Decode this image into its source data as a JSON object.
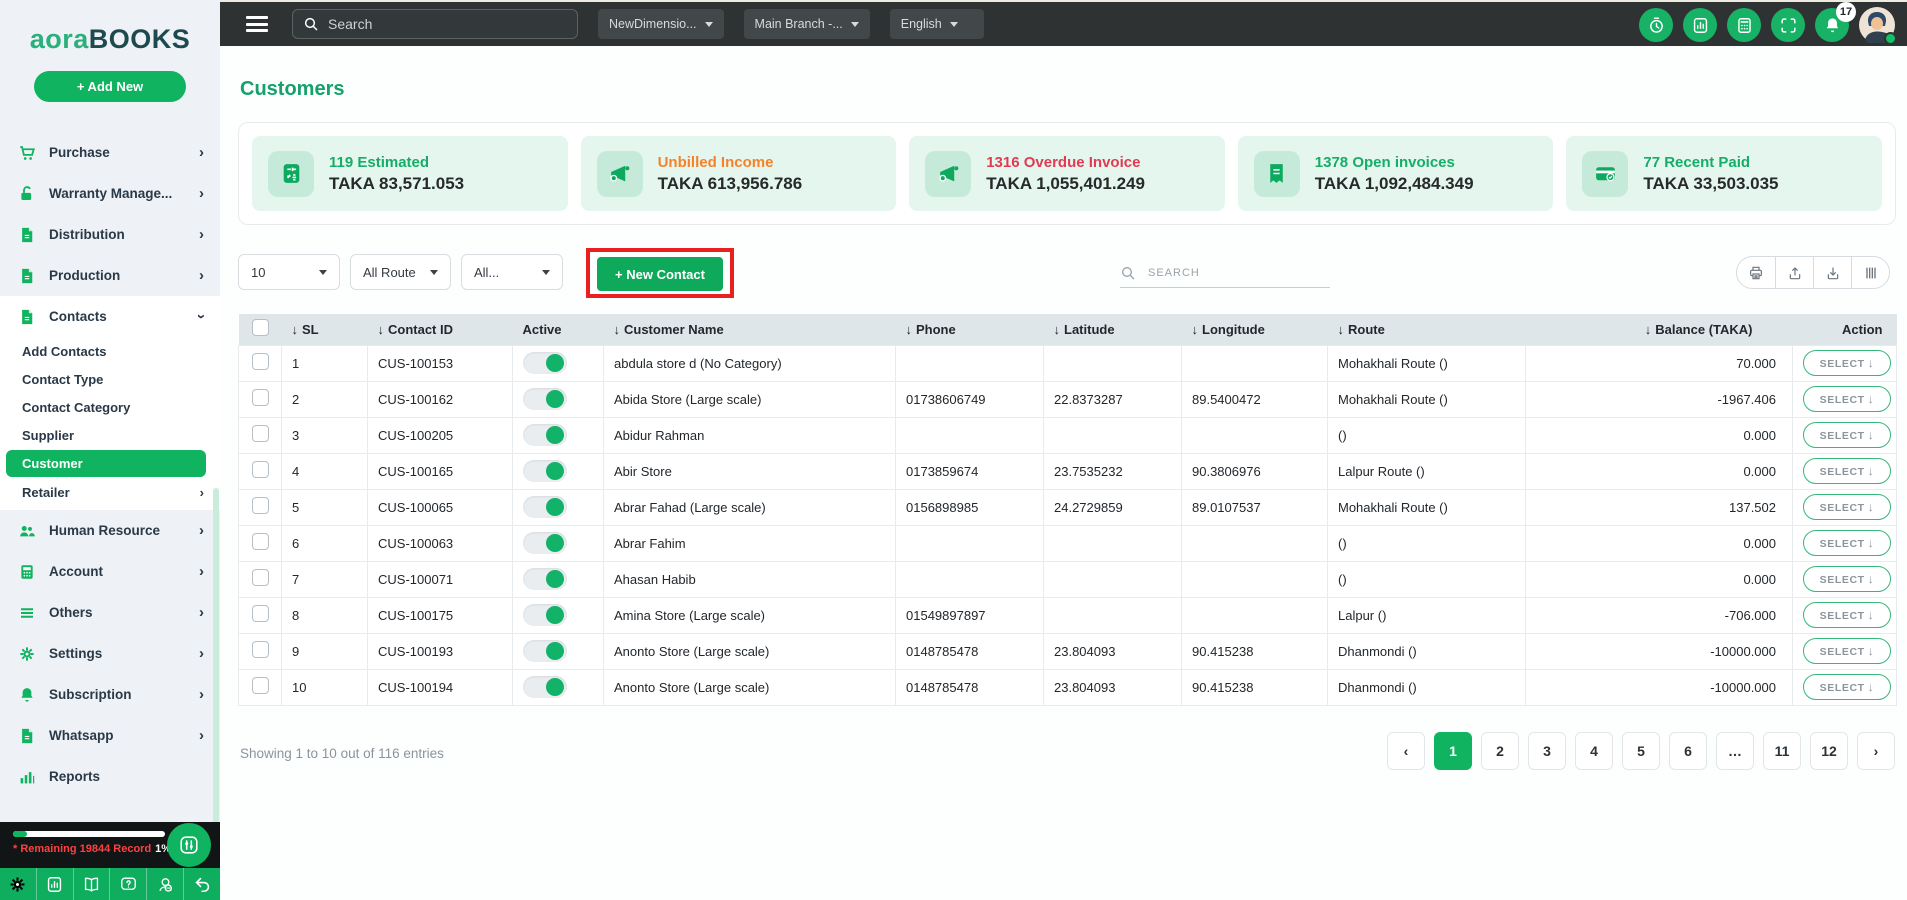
{
  "colors": {
    "primary_green": "#10b35f",
    "topbar_dark": "#2e3233",
    "sidebar_bg": "#eef1f5",
    "card_mint": "#e4f6ed",
    "orange": "#f5822b",
    "red": "#e23b51",
    "annotation_red": "#e8201f"
  },
  "sidebar": {
    "logo_part1": "aora",
    "logo_part2": "BOOKS",
    "add_new_label": "+ Add New",
    "items_top": [
      {
        "label": "Purchase",
        "icon": "cart-icon"
      },
      {
        "label": "Warranty Manage...",
        "icon": "lock-icon"
      },
      {
        "label": "Distribution",
        "icon": "file-icon"
      },
      {
        "label": "Production",
        "icon": "file-icon"
      }
    ],
    "contacts_item": {
      "label": "Contacts",
      "icon": "file-icon"
    },
    "submenu": [
      {
        "label": "Add Contacts"
      },
      {
        "label": "Contact Type"
      },
      {
        "label": "Contact Category"
      },
      {
        "label": "Supplier"
      },
      {
        "label": "Customer",
        "active": true
      },
      {
        "label": "Retailer",
        "chevron": true
      }
    ],
    "items_bottom": [
      {
        "label": "Human Resource",
        "icon": "people-icon"
      },
      {
        "label": "Account",
        "icon": "calculator-icon"
      },
      {
        "label": "Others",
        "icon": "list-icon"
      },
      {
        "label": "Settings",
        "icon": "gear-icon"
      },
      {
        "label": "Subscription",
        "icon": "bell-icon"
      },
      {
        "label": "Whatsapp",
        "icon": "file-icon"
      },
      {
        "label": "Reports",
        "icon": "chart-icon",
        "no_chevron": true
      }
    ],
    "usage": {
      "remaining_label": "* Remaining 19844 Record",
      "percent_label": "1%",
      "progress_pct": 9
    },
    "bottom_icons": [
      "gear-icon",
      "chart-box-icon",
      "book-icon",
      "help-icon",
      "support-icon",
      "undo-icon"
    ]
  },
  "topbar": {
    "search_placeholder": "Search",
    "dropdowns": [
      "NewDimensio...",
      "Main Branch -...",
      "English"
    ],
    "action_icons": [
      "timer-icon",
      "chart-box-icon",
      "calc-white-icon",
      "scan-icon",
      "bell-white-icon"
    ],
    "notification_count": "17"
  },
  "page": {
    "title": "Customers"
  },
  "stat_cards": [
    {
      "title": "119 Estimated",
      "value": "TAKA 83,571.053",
      "color": "#16ad68",
      "icon": "estimate-icon"
    },
    {
      "title": "Unbilled Income",
      "value": "TAKA 613,956.786",
      "color": "#f5822b",
      "icon": "megaphone-icon"
    },
    {
      "title": "1316 Overdue Invoice",
      "value": "TAKA 1,055,401.249",
      "color": "#e23b51",
      "icon": "megaphone-icon"
    },
    {
      "title": "1378 Open invoices",
      "value": "TAKA 1,092,484.349",
      "color": "#16ad68",
      "icon": "invoice-icon"
    },
    {
      "title": "77 Recent Paid",
      "value": "TAKA 33,503.035",
      "color": "#16ad68",
      "icon": "card-icon"
    }
  ],
  "controls": {
    "page_size": "10",
    "route_filter": "All Route",
    "category_filter": "All...",
    "new_contact_label": "+ New Contact",
    "search_placeholder": "SEARCH",
    "tool_icons": [
      "printer-icon",
      "upload-icon",
      "download-icon",
      "columns-icon"
    ]
  },
  "table": {
    "headers": [
      {
        "label": "SL",
        "sort": true
      },
      {
        "label": "Contact ID",
        "sort": true
      },
      {
        "label": "Active",
        "sort": false
      },
      {
        "label": "Customer Name",
        "sort": true
      },
      {
        "label": "Phone",
        "sort": true
      },
      {
        "label": "Latitude",
        "sort": true
      },
      {
        "label": "Longitude",
        "sort": true
      },
      {
        "label": "Route",
        "sort": true
      },
      {
        "label": "Balance (TAKA)",
        "sort": true
      },
      {
        "label": "Action",
        "sort": false
      }
    ],
    "select_label": "SELECT",
    "rows": [
      {
        "sl": "1",
        "contact_id": "CUS-100153",
        "name": "abdula store d (No Category)",
        "phone": "",
        "lat": "",
        "lon": "",
        "route": "Mohakhali Route ()",
        "balance": "70.000"
      },
      {
        "sl": "2",
        "contact_id": "CUS-100162",
        "name": "Abida Store (Large scale)",
        "phone": "01738606749",
        "lat": "22.8373287",
        "lon": "89.5400472",
        "route": "Mohakhali Route ()",
        "balance": "-1967.406"
      },
      {
        "sl": "3",
        "contact_id": "CUS-100205",
        "name": "Abidur Rahman",
        "phone": "",
        "lat": "",
        "lon": "",
        "route": "()",
        "balance": "0.000"
      },
      {
        "sl": "4",
        "contact_id": "CUS-100165",
        "name": "Abir Store",
        "phone": "0173859674",
        "lat": "23.7535232",
        "lon": "90.3806976",
        "route": "Lalpur Route ()",
        "balance": "0.000"
      },
      {
        "sl": "5",
        "contact_id": "CUS-100065",
        "name": "Abrar Fahad (Large scale)",
        "phone": "0156898985",
        "lat": "24.2729859",
        "lon": "89.0107537",
        "route": "Mohakhali Route ()",
        "balance": "137.502"
      },
      {
        "sl": "6",
        "contact_id": "CUS-100063",
        "name": "Abrar Fahim",
        "phone": "",
        "lat": "",
        "lon": "",
        "route": "()",
        "balance": "0.000"
      },
      {
        "sl": "7",
        "contact_id": "CUS-100071",
        "name": "Ahasan Habib",
        "phone": "",
        "lat": "",
        "lon": "",
        "route": "()",
        "balance": "0.000"
      },
      {
        "sl": "8",
        "contact_id": "CUS-100175",
        "name": "Amina Store (Large scale)",
        "phone": "01549897897",
        "lat": "",
        "lon": "",
        "route": "Lalpur ()",
        "balance": "-706.000"
      },
      {
        "sl": "9",
        "contact_id": "CUS-100193",
        "name": "Anonto Store (Large scale)",
        "phone": "0148785478",
        "lat": "23.804093",
        "lon": "90.415238",
        "route": "Dhanmondi ()",
        "balance": "-10000.000"
      },
      {
        "sl": "10",
        "contact_id": "CUS-100194",
        "name": "Anonto Store (Large scale)",
        "phone": "0148785478",
        "lat": "23.804093",
        "lon": "90.415238",
        "route": "Dhanmondi ()",
        "balance": "-10000.000"
      }
    ]
  },
  "footer": {
    "showing_text": "Showing 1 to 10 out of 116 entries",
    "pages": [
      "1",
      "2",
      "3",
      "4",
      "5",
      "6",
      "…",
      "11",
      "12"
    ],
    "active_page": "1"
  }
}
